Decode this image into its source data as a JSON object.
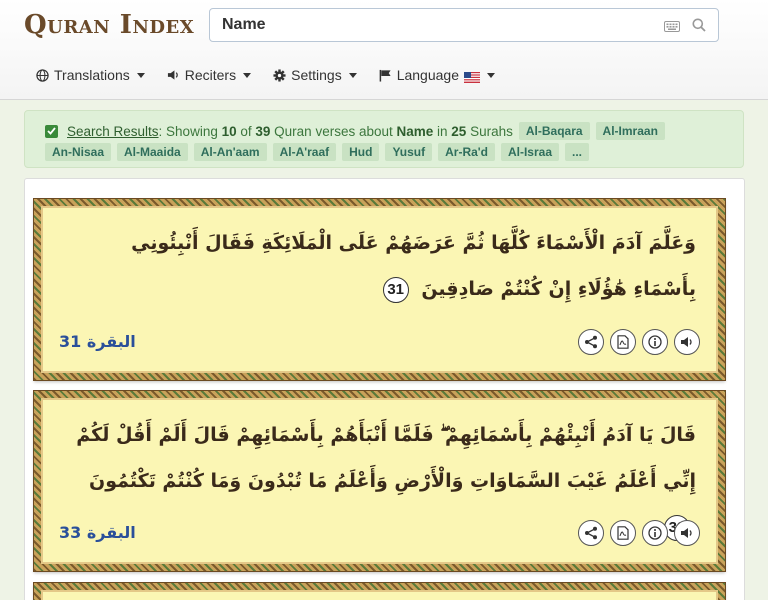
{
  "header": {
    "logo_text": "Quran Index",
    "search": {
      "value": "Name",
      "placeholder": ""
    }
  },
  "nav": {
    "translations": "Translations",
    "reciters": "Reciters",
    "settings": "Settings",
    "language": "Language"
  },
  "results": {
    "link": "Search Results",
    "showing_prefix": ": Showing ",
    "count": "10",
    "of": " of ",
    "total": "39",
    "verses_about": " Quran verses about ",
    "term": "Name",
    "in": " in ",
    "surah_count": "25",
    "surahs": " Surahs",
    "tags_line1": [
      "Al-Baqara",
      "Al-Imraan"
    ],
    "tags_line2": [
      "An-Nisaa",
      "Al-Maaida",
      "Al-An'aam",
      "Al-A'raaf",
      "Hud",
      "Yusuf",
      "Ar-Ra'd",
      "Al-Israa",
      "..."
    ]
  },
  "verses": [
    {
      "text": "وَعَلَّمَ آدَمَ الْأَسْمَاءَ كُلَّهَا ثُمَّ عَرَضَهُمْ عَلَى الْمَلَائِكَةِ فَقَالَ أَنْبِئُونِي بِأَسْمَاءِ هَٰؤُلَاءِ إِنْ كُنْتُمْ صَادِقِينَ",
      "number": "31",
      "reference": "البقرة 31"
    },
    {
      "text": "قَالَ يَا آدَمُ أَنْبِئْهُمْ بِأَسْمَائِهِمْ ۖ فَلَمَّا أَنْبَأَهُمْ بِأَسْمَائِهِمْ قَالَ أَلَمْ أَقُلْ لَكُمْ إِنِّي أَعْلَمُ غَيْبَ السَّمَاوَاتِ وَالْأَرْضِ وَأَعْلَمُ مَا تُبْدُونَ وَمَا كُنْتُمْ تَكْتُمُونَ",
      "number": "33",
      "reference": "البقرة 33"
    }
  ],
  "icons": [
    "globe-icon",
    "volume-icon",
    "gear-icon",
    "flag-icon",
    "keyboard-icon",
    "search-icon",
    "share-icon",
    "pdf-icon",
    "info-icon",
    "audio-icon"
  ],
  "colors": {
    "accent_green": "#3c763d",
    "verse_bg": "#fbf6b4",
    "reference_blue": "#2a4f9a"
  }
}
